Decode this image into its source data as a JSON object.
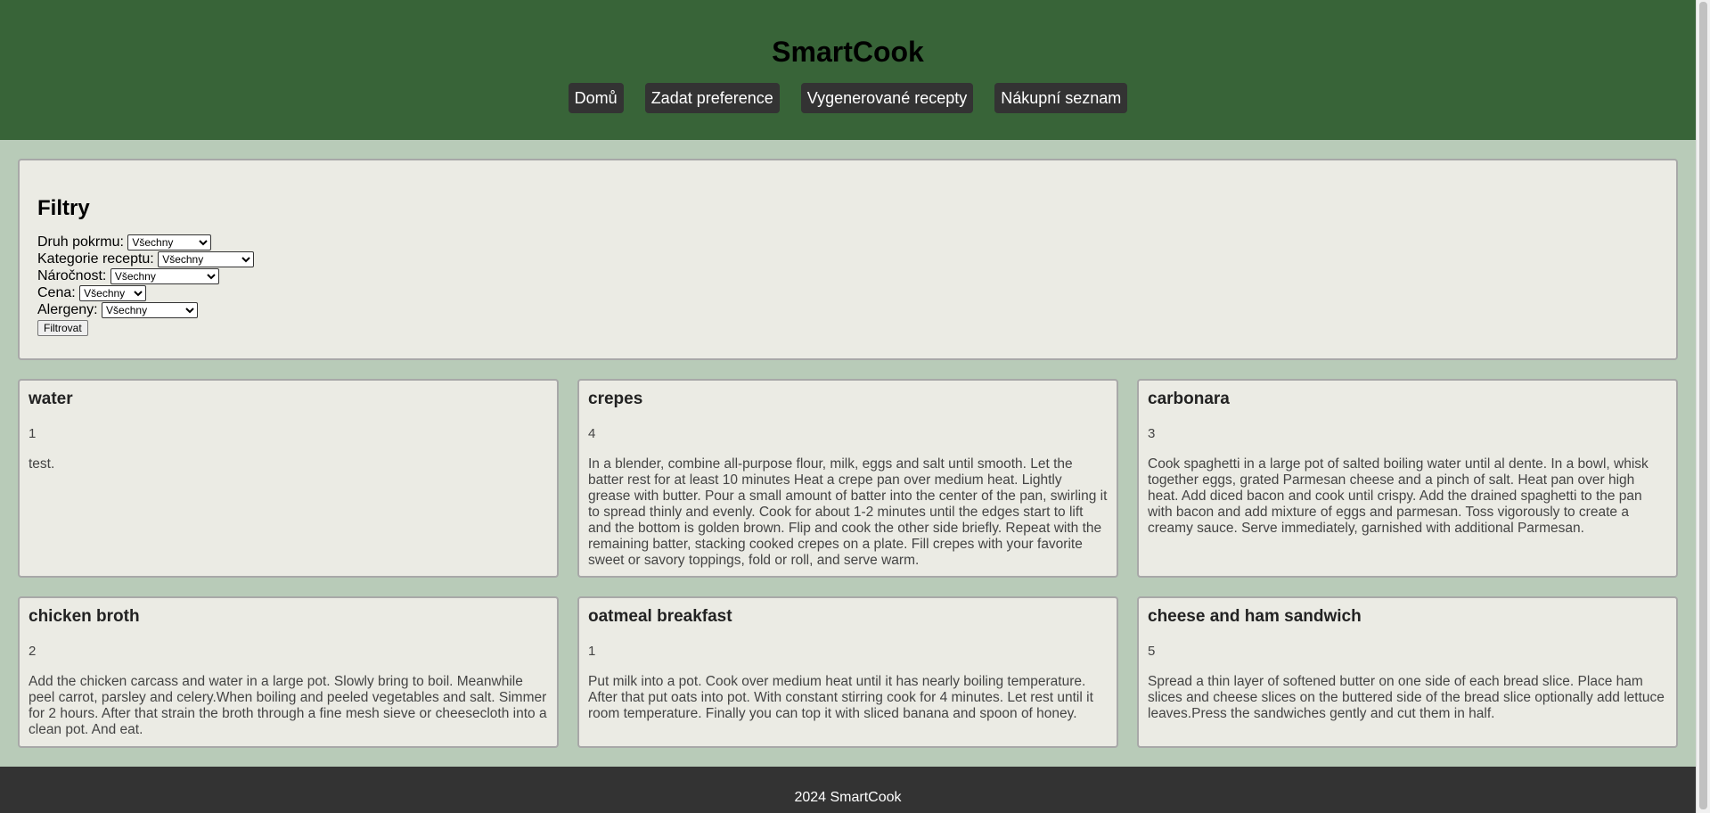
{
  "header": {
    "title": "SmartCook",
    "nav": [
      "Domů",
      "Zadat preference",
      "Vygenerované recepty",
      "Nákupní seznam"
    ]
  },
  "filters": {
    "title": "Filtry",
    "fields": [
      {
        "label": "Druh pokrmu:",
        "value": "Všechny"
      },
      {
        "label": "Kategorie receptu:",
        "value": "Všechny"
      },
      {
        "label": "Náročnost:",
        "value": "Všechny"
      },
      {
        "label": "Cena:",
        "value": "Všechny"
      },
      {
        "label": "Alergeny:",
        "value": "Všechny"
      }
    ],
    "button": "Filtrovat"
  },
  "recipes": [
    {
      "title": "water",
      "rating": "1",
      "description": "test."
    },
    {
      "title": "crepes",
      "rating": "4",
      "description": "In a blender, combine all-purpose flour, milk, eggs and salt until smooth. Let the batter rest for at least 10 minutes Heat a crepe pan over medium heat. Lightly grease with butter. Pour a small amount of batter into the center of the pan, swirling it to spread thinly and evenly. Cook for about 1-2 minutes until the edges start to lift and the bottom is golden brown. Flip and cook the other side briefly. Repeat with the remaining batter, stacking cooked crepes on a plate. Fill crepes with your favorite sweet or savory toppings, fold or roll, and serve warm."
    },
    {
      "title": "carbonara",
      "rating": "3",
      "description": "Cook spaghetti in a large pot of salted boiling water until al dente. In a bowl, whisk together eggs, grated Parmesan cheese and a pinch of salt. Heat pan over high heat. Add diced bacon and cook until crispy. Add the drained spaghetti to the pan with bacon and add mixture of eggs and parmesan. Toss vigorously to create a creamy sauce. Serve immediately, garnished with additional Parmesan."
    },
    {
      "title": "chicken broth",
      "rating": "2",
      "description": "Add the chicken carcass and water in a large pot. Slowly bring to boil. Meanwhile peel carrot, parsley and celery.When boiling and peeled vegetables and salt. Simmer for 2 hours. After that strain the broth through a fine mesh sieve or cheesecloth into a clean pot. And eat."
    },
    {
      "title": "oatmeal breakfast",
      "rating": "1",
      "description": "Put milk into a pot. Cook over medium heat until it has nearly boiling temperature. After that put oats into pot. With constant stirring cook for 4 minutes. Let rest until it room temperature. Finally you can top it with sliced banana and spoon of honey."
    },
    {
      "title": "cheese and ham sandwich",
      "rating": "5",
      "description": "Spread a thin layer of softened butter on one side of each bread slice. Place ham slices and cheese slices on the buttered side of the bread slice optionally add lettuce leaves.Press the sandwiches gently and cut them in half."
    }
  ],
  "footer": {
    "text": "2024 SmartCook"
  }
}
